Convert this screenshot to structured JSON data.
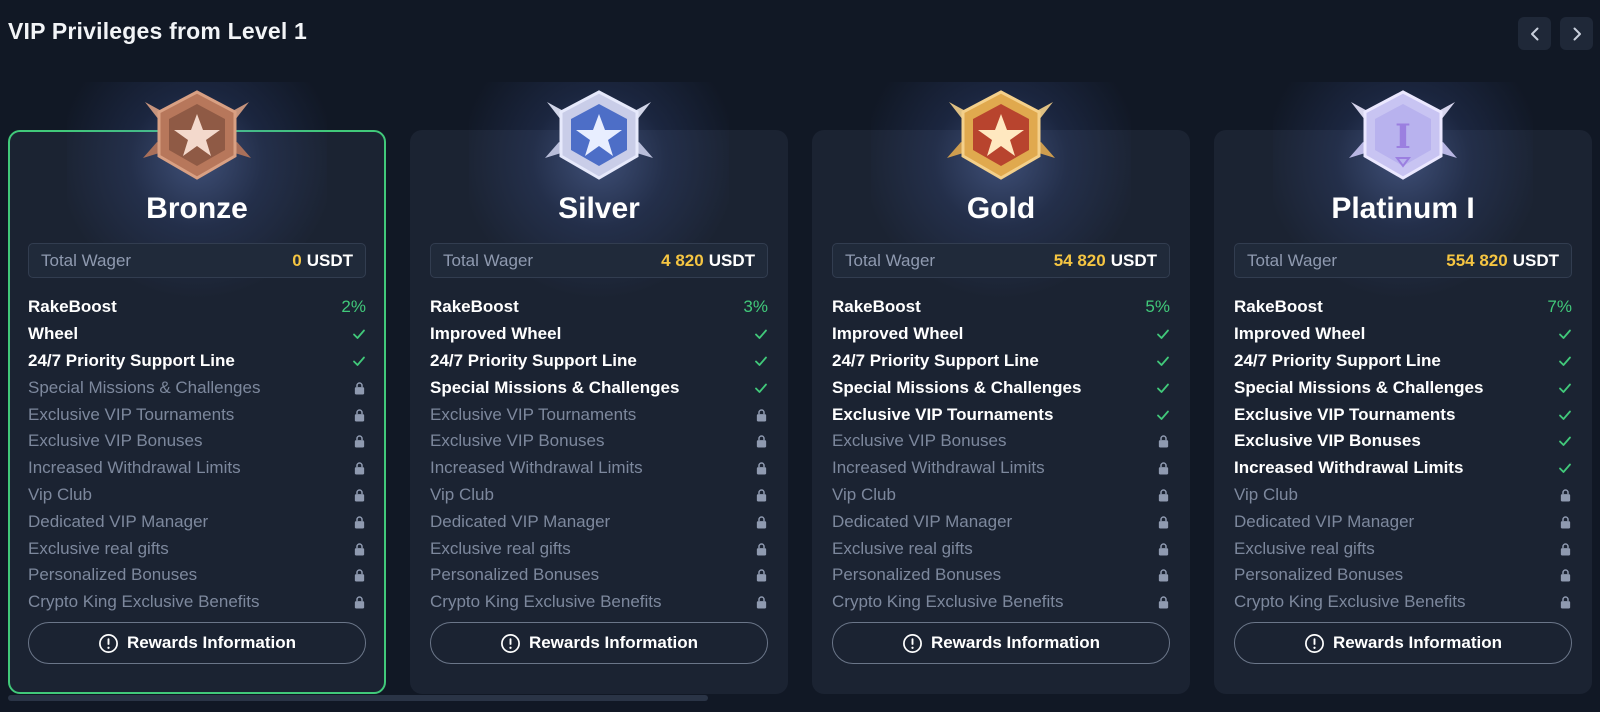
{
  "header": {
    "title": "VIP Privileges from Level 1"
  },
  "colors": {
    "accent_green": "#41c97a",
    "gold": "#f5c542",
    "locked_text": "#7d889d"
  },
  "cards": [
    {
      "name": "Bronze",
      "badge": "bronze-star-badge-icon",
      "wager_label": "Total Wager",
      "wager_amount": "0",
      "wager_unit": "USDT",
      "button_label": "Rewards Information",
      "perks": [
        {
          "label": "RakeBoost",
          "value": "2%",
          "status": "percent"
        },
        {
          "label": "Wheel",
          "status": "unlocked"
        },
        {
          "label": "24/7 Priority Support Line",
          "status": "unlocked"
        },
        {
          "label": "Special Missions & Challenges",
          "status": "locked"
        },
        {
          "label": "Exclusive VIP Tournaments",
          "status": "locked"
        },
        {
          "label": "Exclusive VIP Bonuses",
          "status": "locked"
        },
        {
          "label": "Increased Withdrawal Limits",
          "status": "locked"
        },
        {
          "label": "Vip Club",
          "status": "locked"
        },
        {
          "label": "Dedicated VIP Manager",
          "status": "locked"
        },
        {
          "label": "Exclusive real gifts",
          "status": "locked"
        },
        {
          "label": "Personalized Bonuses",
          "status": "locked"
        },
        {
          "label": "Crypto King Exclusive Benefits",
          "status": "locked"
        }
      ]
    },
    {
      "name": "Silver",
      "badge": "silver-star-badge-icon",
      "wager_label": "Total Wager",
      "wager_amount": "4 820",
      "wager_unit": "USDT",
      "button_label": "Rewards Information",
      "perks": [
        {
          "label": "RakeBoost",
          "value": "3%",
          "status": "percent"
        },
        {
          "label": "Improved Wheel",
          "status": "unlocked"
        },
        {
          "label": "24/7 Priority Support Line",
          "status": "unlocked"
        },
        {
          "label": "Special Missions & Challenges",
          "status": "unlocked"
        },
        {
          "label": "Exclusive VIP Tournaments",
          "status": "locked"
        },
        {
          "label": "Exclusive VIP Bonuses",
          "status": "locked"
        },
        {
          "label": "Increased Withdrawal Limits",
          "status": "locked"
        },
        {
          "label": "Vip Club",
          "status": "locked"
        },
        {
          "label": "Dedicated VIP Manager",
          "status": "locked"
        },
        {
          "label": "Exclusive real gifts",
          "status": "locked"
        },
        {
          "label": "Personalized Bonuses",
          "status": "locked"
        },
        {
          "label": "Crypto King Exclusive Benefits",
          "status": "locked"
        }
      ]
    },
    {
      "name": "Gold",
      "badge": "gold-star-badge-icon",
      "wager_label": "Total Wager",
      "wager_amount": "54 820",
      "wager_unit": "USDT",
      "button_label": "Rewards Information",
      "perks": [
        {
          "label": "RakeBoost",
          "value": "5%",
          "status": "percent"
        },
        {
          "label": "Improved Wheel",
          "status": "unlocked"
        },
        {
          "label": "24/7 Priority Support Line",
          "status": "unlocked"
        },
        {
          "label": "Special Missions & Challenges",
          "status": "unlocked"
        },
        {
          "label": "Exclusive VIP Tournaments",
          "status": "unlocked"
        },
        {
          "label": "Exclusive VIP Bonuses",
          "status": "locked"
        },
        {
          "label": "Increased Withdrawal Limits",
          "status": "locked"
        },
        {
          "label": "Vip Club",
          "status": "locked"
        },
        {
          "label": "Dedicated VIP Manager",
          "status": "locked"
        },
        {
          "label": "Exclusive real gifts",
          "status": "locked"
        },
        {
          "label": "Personalized Bonuses",
          "status": "locked"
        },
        {
          "label": "Crypto King Exclusive Benefits",
          "status": "locked"
        }
      ]
    },
    {
      "name": "Platinum I",
      "badge": "platinum-numeral-badge-icon",
      "badge_text": "I",
      "wager_label": "Total Wager",
      "wager_amount": "554 820",
      "wager_unit": "USDT",
      "button_label": "Rewards Information",
      "perks": [
        {
          "label": "RakeBoost",
          "value": "7%",
          "status": "percent"
        },
        {
          "label": "Improved Wheel",
          "status": "unlocked"
        },
        {
          "label": "24/7 Priority Support Line",
          "status": "unlocked"
        },
        {
          "label": "Special Missions & Challenges",
          "status": "unlocked"
        },
        {
          "label": "Exclusive VIP Tournaments",
          "status": "unlocked"
        },
        {
          "label": "Exclusive VIP Bonuses",
          "status": "unlocked"
        },
        {
          "label": "Increased Withdrawal Limits",
          "status": "unlocked"
        },
        {
          "label": "Vip Club",
          "status": "locked"
        },
        {
          "label": "Dedicated VIP Manager",
          "status": "locked"
        },
        {
          "label": "Exclusive real gifts",
          "status": "locked"
        },
        {
          "label": "Personalized Bonuses",
          "status": "locked"
        },
        {
          "label": "Crypto King Exclusive Benefits",
          "status": "locked"
        }
      ]
    }
  ]
}
